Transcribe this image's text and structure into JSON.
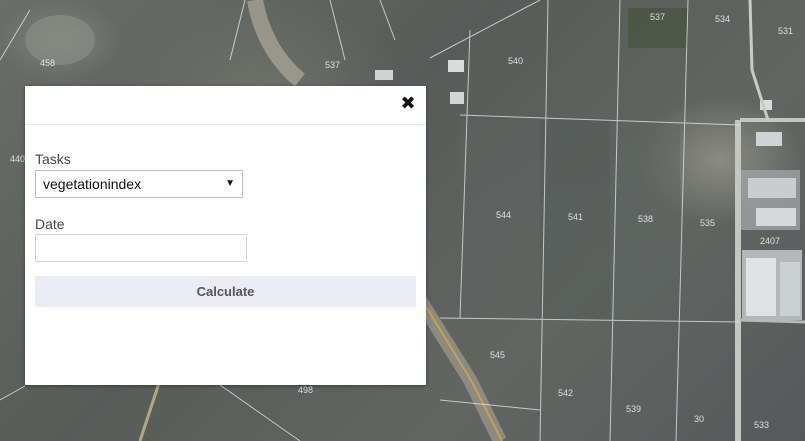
{
  "map": {
    "parcel_labels": [
      "458",
      "440",
      "537",
      "540",
      "537",
      "534",
      "531",
      "544",
      "541",
      "538",
      "535",
      "2407",
      "545",
      "542",
      "539",
      "30",
      "533",
      "498"
    ]
  },
  "modal": {
    "close_glyph": "✖",
    "tasks_label": "Tasks",
    "task_selected": "vegetationindex",
    "date_label": "Date",
    "date_value": "",
    "calculate_label": "Calculate"
  }
}
